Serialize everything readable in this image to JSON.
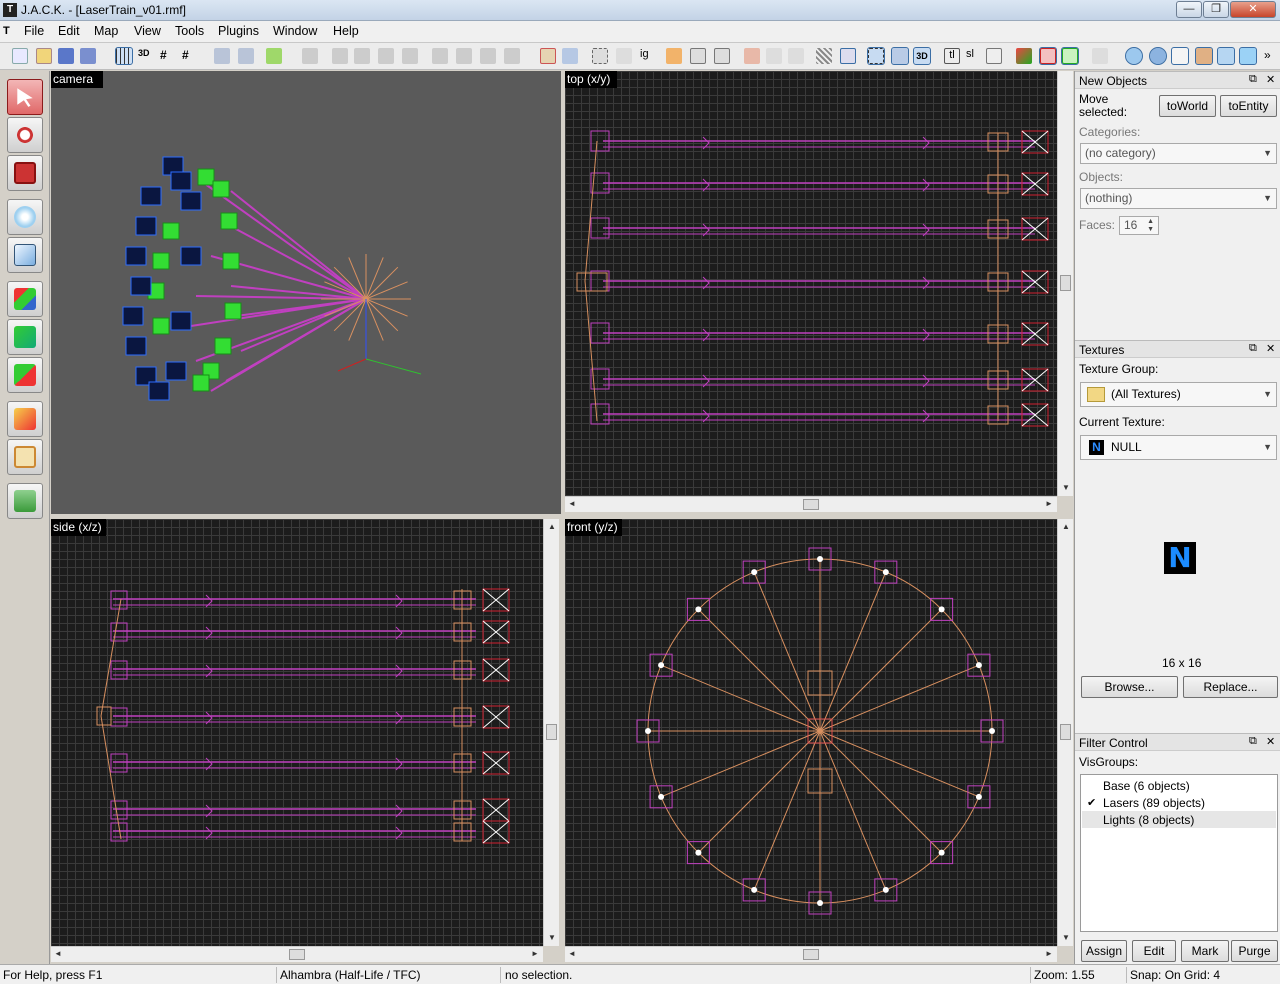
{
  "window": {
    "title": "J.A.C.K. - [LaserTrain_v01.rmf]",
    "min": "—",
    "max": "❐",
    "close": "✕"
  },
  "menu": [
    "File",
    "Edit",
    "Map",
    "View",
    "Tools",
    "Plugins",
    "Window",
    "Help"
  ],
  "viewports": {
    "camera": "camera",
    "top": "top (x/y)",
    "side": "side (x/z)",
    "front": "front (y/z)"
  },
  "new_objects": {
    "title": "New Objects",
    "move_label": "Move\nselected:",
    "to_world": "toWorld",
    "to_entity": "toEntity",
    "categories_label": "Categories:",
    "categories_value": "(no category)",
    "objects_label": "Objects:",
    "objects_value": "(nothing)",
    "faces_label": "Faces:",
    "faces_value": "16"
  },
  "textures": {
    "title": "Textures",
    "group_label": "Texture Group:",
    "group_value": "(All Textures)",
    "current_label": "Current Texture:",
    "current_value": "NULL",
    "size": "16 x 16",
    "browse": "Browse...",
    "replace": "Replace..."
  },
  "filter": {
    "title": "Filter Control",
    "visgroups_label": "VisGroups:",
    "items": [
      "Base (6 objects)",
      "Lasers (89 objects)",
      "Lights (8 objects)"
    ],
    "assign": "Assign",
    "edit": "Edit",
    "mark": "Mark",
    "purge": "Purge"
  },
  "status": {
    "help": "For Help, press F1",
    "game": "Alhambra (Half-Life / TFC)",
    "selection": "no selection.",
    "zoom": "Zoom: 1.55",
    "snap": "Snap: On Grid: 4"
  },
  "colors": {
    "laser": "#c040c0",
    "entity": "#d89060",
    "accent": "#3b6ea5"
  }
}
